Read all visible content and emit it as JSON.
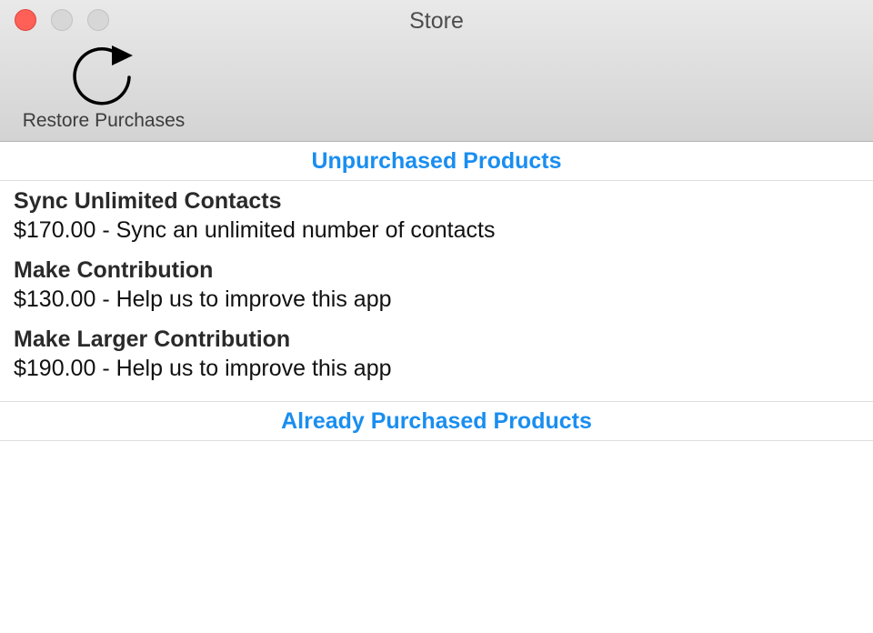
{
  "window": {
    "title": "Store"
  },
  "toolbar": {
    "restore_label": "Restore Purchases",
    "restore_icon": "refresh-icon"
  },
  "sections": {
    "unpurchased": {
      "title": "Unpurchased Products",
      "items": [
        {
          "name": "Sync Unlimited Contacts",
          "description": "$170.00 - Sync an unlimited number of contacts"
        },
        {
          "name": "Make Contribution",
          "description": "$130.00 - Help us to improve this app"
        },
        {
          "name": "Make Larger Contribution",
          "description": "$190.00 - Help us to improve this app"
        }
      ]
    },
    "purchased": {
      "title": "Already Purchased Products",
      "items": []
    }
  },
  "colors": {
    "accent": "#1a8ef0",
    "close_button": "#fe5f57"
  }
}
